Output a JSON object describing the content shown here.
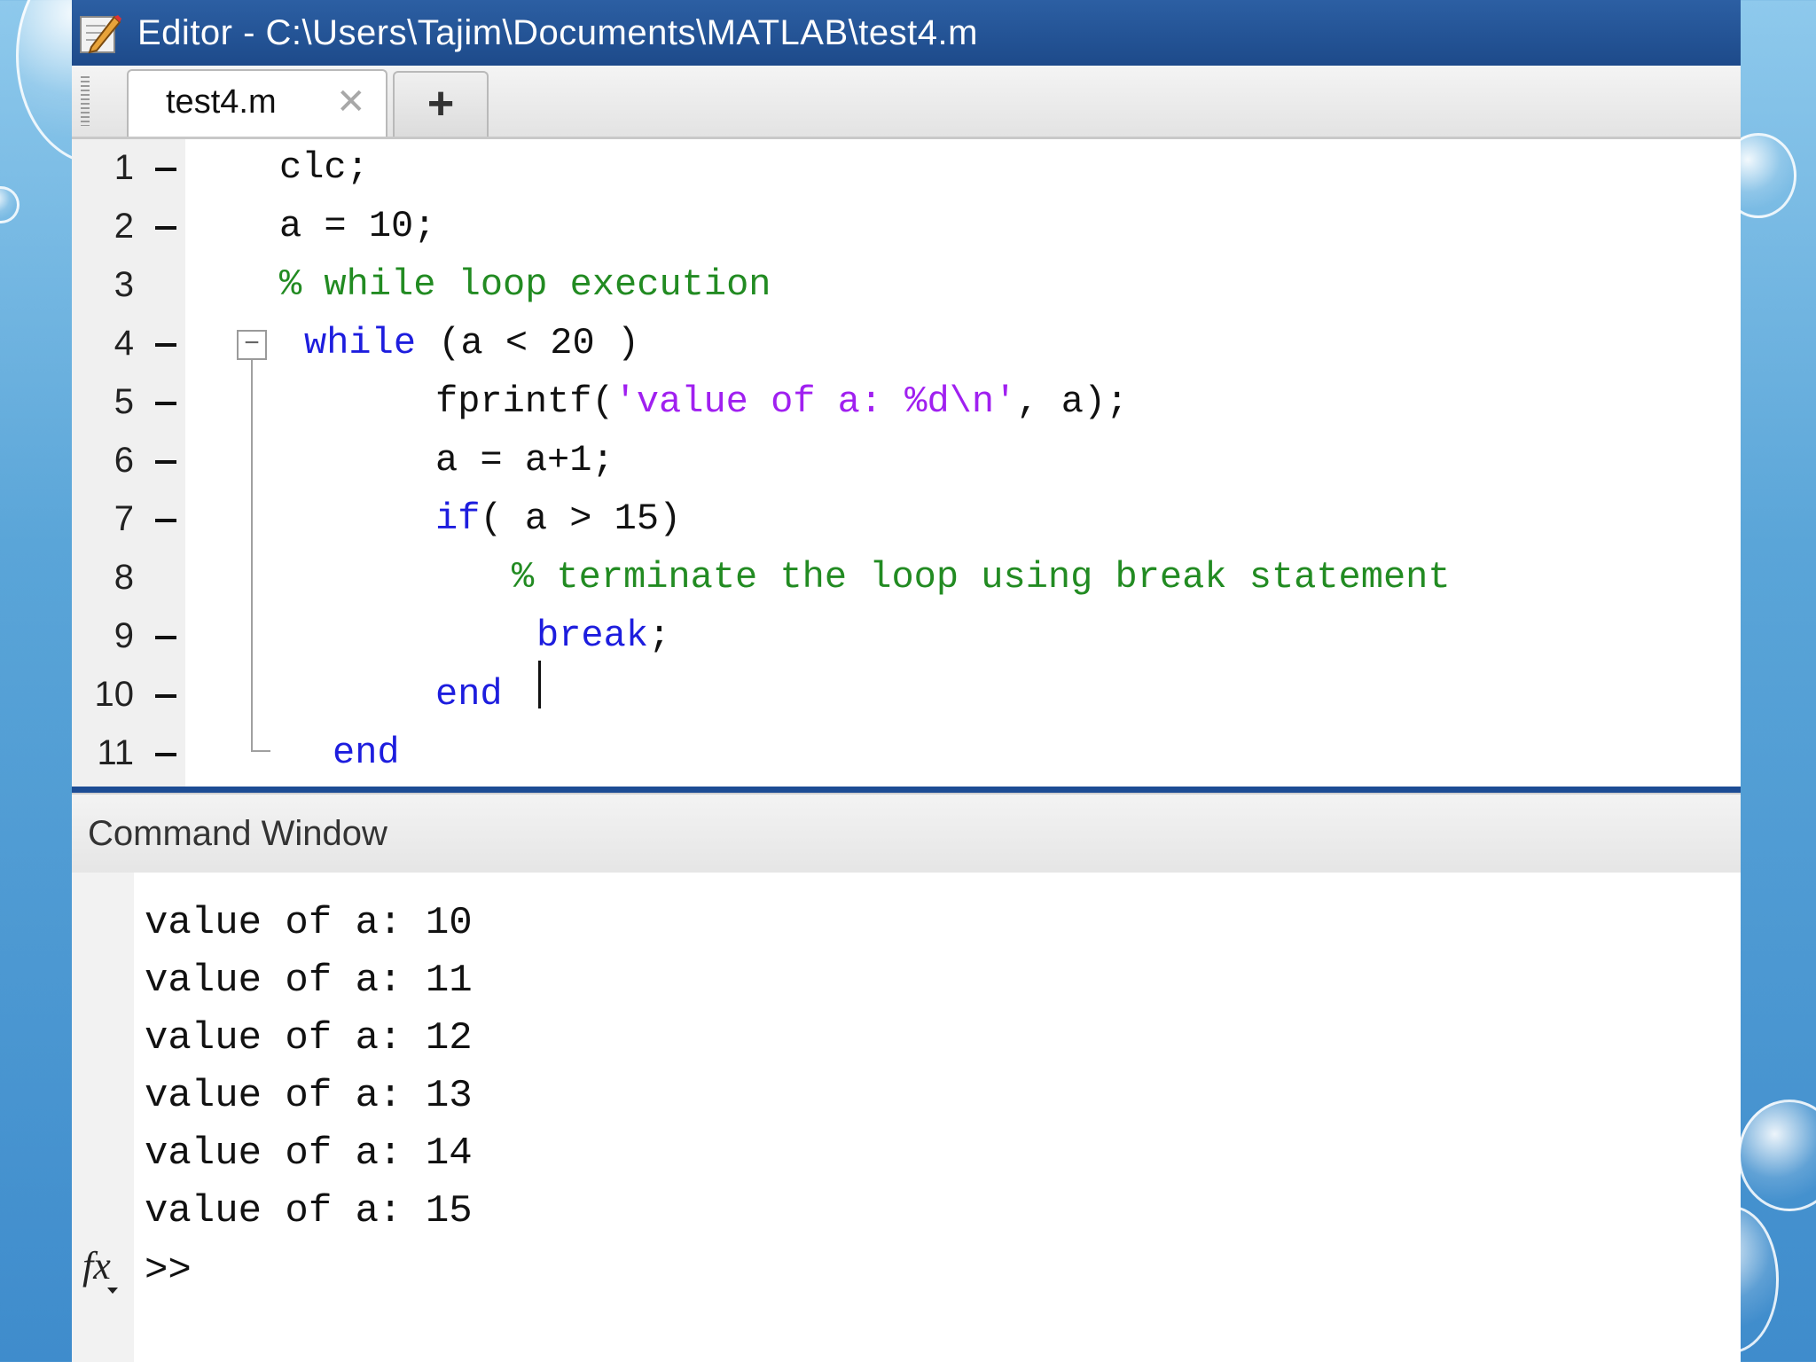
{
  "window": {
    "title": "Editor - C:\\Users\\Tajim\\Documents\\MATLAB\\test4.m"
  },
  "tabs": {
    "active_label": "test4.m",
    "close_glyph": "✕",
    "add_glyph": "+"
  },
  "editor": {
    "lines": [
      {
        "num": "1",
        "exec": true
      },
      {
        "num": "2",
        "exec": true
      },
      {
        "num": "3",
        "exec": false
      },
      {
        "num": "4",
        "exec": true
      },
      {
        "num": "5",
        "exec": true
      },
      {
        "num": "6",
        "exec": true
      },
      {
        "num": "7",
        "exec": true
      },
      {
        "num": "8",
        "exec": false
      },
      {
        "num": "9",
        "exec": true
      },
      {
        "num": "10",
        "exec": true
      },
      {
        "num": "11",
        "exec": true
      }
    ],
    "code": {
      "l1": "clc;",
      "l2": "a = 10;",
      "l3_comment": "% while loop execution",
      "l4_kw": "while",
      "l4_rest": " (a < 20 )",
      "l5_fn": "fprintf(",
      "l5_str": "'value of a: %d\\n'",
      "l5_rest": ", a);",
      "l6": "a = a+1;",
      "l7_kw": "if",
      "l7_rest": "( a > 15)",
      "l8_comment": "% terminate the loop using break statement",
      "l9_kw": "break",
      "l9_rest": ";",
      "l10_kw": "end",
      "l11_kw": "end"
    },
    "fold_glyph": "−"
  },
  "command_window": {
    "title": "Command Window",
    "output": [
      "value of a: 10",
      "value of a: 11",
      "value of a: 12",
      "value of a: 13",
      "value of a: 14",
      "value of a: 15"
    ],
    "fx_label": "fx",
    "prompt": ">>"
  },
  "colors": {
    "keyword": "#1d1dde",
    "comment": "#228b22",
    "string": "#a020f0",
    "titlebar": "#1d4a8a"
  }
}
